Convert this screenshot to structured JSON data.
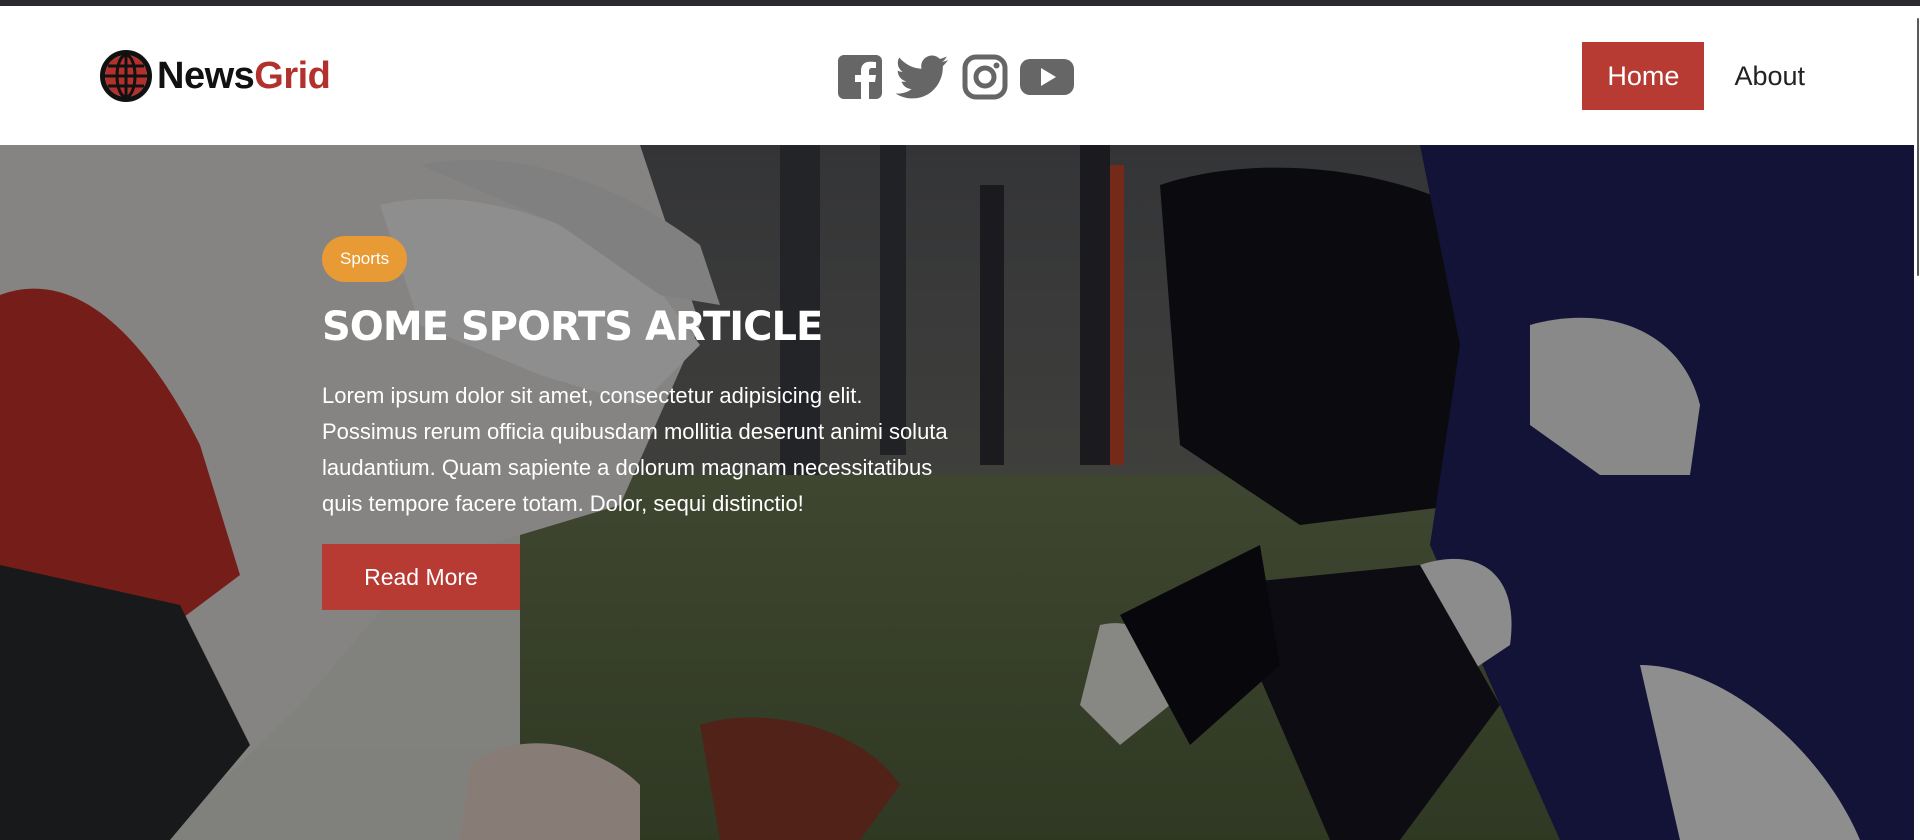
{
  "brand": {
    "name_part1": "News",
    "name_part2": "Grid",
    "accent_color": "#b3312c"
  },
  "social": [
    {
      "icon": "facebook-icon"
    },
    {
      "icon": "twitter-icon"
    },
    {
      "icon": "instagram-icon"
    },
    {
      "icon": "youtube-icon"
    }
  ],
  "nav": {
    "items": [
      {
        "label": "Home",
        "active": true
      },
      {
        "label": "About",
        "active": false
      }
    ],
    "active_color": "#b73a33"
  },
  "hero": {
    "category": "Sports",
    "category_color": "#e89a35",
    "title": "Some Sports Article",
    "body": "Lorem ipsum dolor sit amet, consectetur adipisicing elit. Possimus rerum officia quibusdam mollitia deserunt animi soluta laudantium. Quam sapiente a dolorum magnam necessitatibus quis tempore facere totam. Dolor, sequi distinctio!",
    "button_label": "Read More",
    "button_color": "#b73a33"
  }
}
